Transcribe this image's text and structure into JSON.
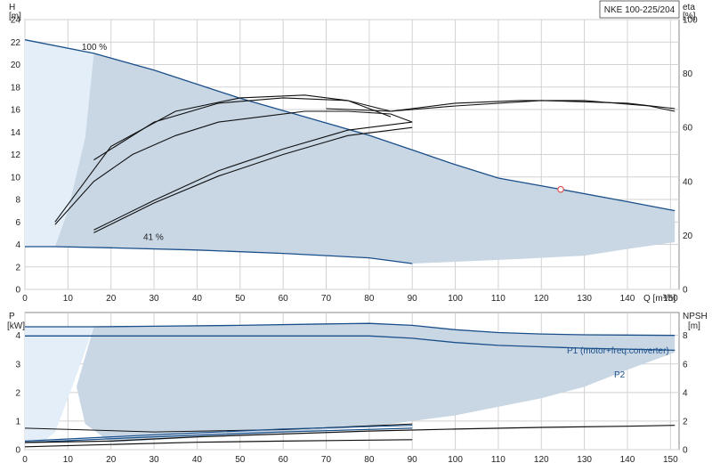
{
  "chart_data": [
    {
      "type": "line",
      "panel": "head_and_efficiency",
      "title": "NKE 100-225/204",
      "y_left_label": [
        "H",
        "[m]"
      ],
      "y_right_label": [
        "eta",
        "[%]"
      ],
      "x_label": "Q [m³/h]",
      "x_ticks": [
        0,
        10,
        20,
        30,
        40,
        50,
        60,
        70,
        80,
        90,
        100,
        110,
        120,
        130,
        140,
        150
      ],
      "y_left_ticks": [
        0,
        2,
        4,
        6,
        8,
        10,
        12,
        14,
        16,
        18,
        20,
        22,
        24
      ],
      "y_right_ticks": [
        0,
        20,
        40,
        60,
        80,
        100
      ],
      "xlim": [
        0,
        152
      ],
      "ylim_left": [
        0,
        24
      ],
      "ylim_right": [
        0,
        100
      ],
      "grid": true,
      "annotations": [
        "100 %",
        "41 %"
      ],
      "duty_point": {
        "x": 124.5,
        "y": 8.9
      },
      "colors": {
        "curve": "#1a4f8a",
        "eta": "#111111",
        "region": "#c9d7e5",
        "region_light": "#e3eef9",
        "grid": "#d2d2d2",
        "marker": "#e05050"
      },
      "series": [
        {
          "id": "h_max",
          "x": [
            0,
            16,
            30,
            50,
            70,
            80,
            90,
            100,
            110,
            124.5,
            140,
            151
          ],
          "y": [
            22.2,
            21.0,
            19.5,
            17.0,
            14.8,
            13.7,
            12.4,
            11.1,
            9.9,
            8.9,
            7.8,
            7.0
          ]
        },
        {
          "id": "h_min",
          "x": [
            0,
            7,
            20,
            40,
            60,
            80,
            90
          ],
          "y": [
            3.8,
            3.8,
            3.7,
            3.5,
            3.2,
            2.8,
            2.3
          ]
        },
        {
          "id": "region_right",
          "x": [
            151,
            140,
            130,
            115,
            90
          ],
          "y": [
            4.2,
            3.6,
            3.0,
            2.7,
            2.3
          ]
        },
        {
          "id": "left_edge",
          "x": [
            7,
            10,
            14,
            16
          ],
          "y": [
            3.8,
            7.0,
            13.5,
            21.0
          ]
        },
        {
          "id": "eta_max_full",
          "x": [
            7,
            16,
            25,
            35,
            45,
            55,
            65,
            75,
            85,
            90
          ],
          "y": [
            24,
            40,
            50,
            57,
            62,
            64,
            66,
            66,
            65,
            62
          ]
        },
        {
          "id": "eta_max_upper",
          "x": [
            16,
            30,
            45,
            60,
            75,
            85
          ],
          "y": [
            48,
            62,
            69,
            71,
            70,
            66
          ]
        },
        {
          "id": "eta_max_right",
          "x": [
            85,
            100,
            115,
            130,
            145,
            151
          ],
          "y": [
            66,
            69,
            70,
            70,
            68,
            66
          ]
        },
        {
          "id": "eta_max_top",
          "x": [
            70,
            85,
            100,
            120,
            140,
            151
          ],
          "y": [
            67,
            66,
            68,
            70,
            69,
            67
          ]
        },
        {
          "id": "eta_min_lower",
          "x": [
            16,
            30,
            45,
            60,
            75,
            90
          ],
          "y": [
            21,
            32,
            42,
            50,
            57,
            60
          ]
        },
        {
          "id": "eta_min_upper",
          "x": [
            16,
            30,
            45,
            60,
            75,
            90
          ],
          "y": [
            22,
            33,
            44,
            52,
            59,
            62
          ]
        },
        {
          "id": "eta_100_upper",
          "x": [
            7,
            20,
            35,
            50,
            65,
            75,
            85
          ],
          "y": [
            25,
            53,
            66,
            71,
            72,
            70,
            64
          ]
        }
      ]
    },
    {
      "type": "line",
      "panel": "power_and_npsh",
      "y_left_label": [
        "P",
        "[kW]"
      ],
      "y_right_label": [
        "NPSH",
        "[m]"
      ],
      "x_ticks": [
        0,
        10,
        20,
        30,
        40,
        50,
        60,
        70,
        80,
        90,
        100,
        110,
        120,
        130,
        140,
        150
      ],
      "y_left_ticks": [
        0,
        1,
        2,
        3,
        4
      ],
      "y_right_ticks": [
        0,
        2,
        4,
        6,
        8
      ],
      "xlim": [
        0,
        152
      ],
      "ylim_left": [
        0,
        4.8
      ],
      "ylim_right": [
        0,
        9.6
      ],
      "grid": true,
      "legend": [
        "P1 (motor+freq.converter)",
        "P2"
      ],
      "series": [
        {
          "id": "P1",
          "x": [
            0,
            16,
            30,
            50,
            70,
            80,
            90,
            100,
            110,
            120,
            130,
            140,
            151
          ],
          "y": [
            4.3,
            4.3,
            4.32,
            4.35,
            4.4,
            4.42,
            4.35,
            4.2,
            4.1,
            4.05,
            4.02,
            4.01,
            4.0
          ]
        },
        {
          "id": "P2",
          "x": [
            0,
            16,
            30,
            50,
            70,
            80,
            90,
            100,
            110,
            120,
            130,
            140,
            151
          ],
          "y": [
            3.98,
            3.98,
            3.98,
            3.98,
            3.98,
            3.98,
            3.9,
            3.75,
            3.65,
            3.6,
            3.55,
            3.52,
            3.48
          ]
        },
        {
          "id": "region_bottom",
          "x": [
            0,
            20,
            40,
            60,
            80,
            100,
            120,
            130,
            140,
            151
          ],
          "y": [
            0.22,
            0.25,
            0.42,
            0.6,
            0.8,
            1.2,
            1.8,
            2.2,
            2.8,
            3.4
          ]
        },
        {
          "id": "P_low_1",
          "x": [
            0,
            30,
            60,
            90
          ],
          "y": [
            0.75,
            0.62,
            0.7,
            0.9
          ]
        },
        {
          "id": "P_low_2",
          "x": [
            0,
            30,
            60,
            90
          ],
          "y": [
            0.3,
            0.52,
            0.72,
            0.85
          ]
        },
        {
          "id": "P_low_3",
          "x": [
            0,
            30,
            60,
            90
          ],
          "y": [
            0.25,
            0.45,
            0.62,
            0.75
          ]
        },
        {
          "id": "NPSH_full",
          "x": [
            0,
            20,
            40,
            60,
            80,
            100,
            120,
            140,
            151
          ],
          "y": [
            0.25,
            0.3,
            0.45,
            0.55,
            0.65,
            0.72,
            0.78,
            0.82,
            0.85
          ]
        },
        {
          "id": "NPSH_min",
          "x": [
            0,
            20,
            40,
            60,
            90
          ],
          "y": [
            0.1,
            0.18,
            0.26,
            0.3,
            0.35
          ]
        }
      ]
    }
  ]
}
